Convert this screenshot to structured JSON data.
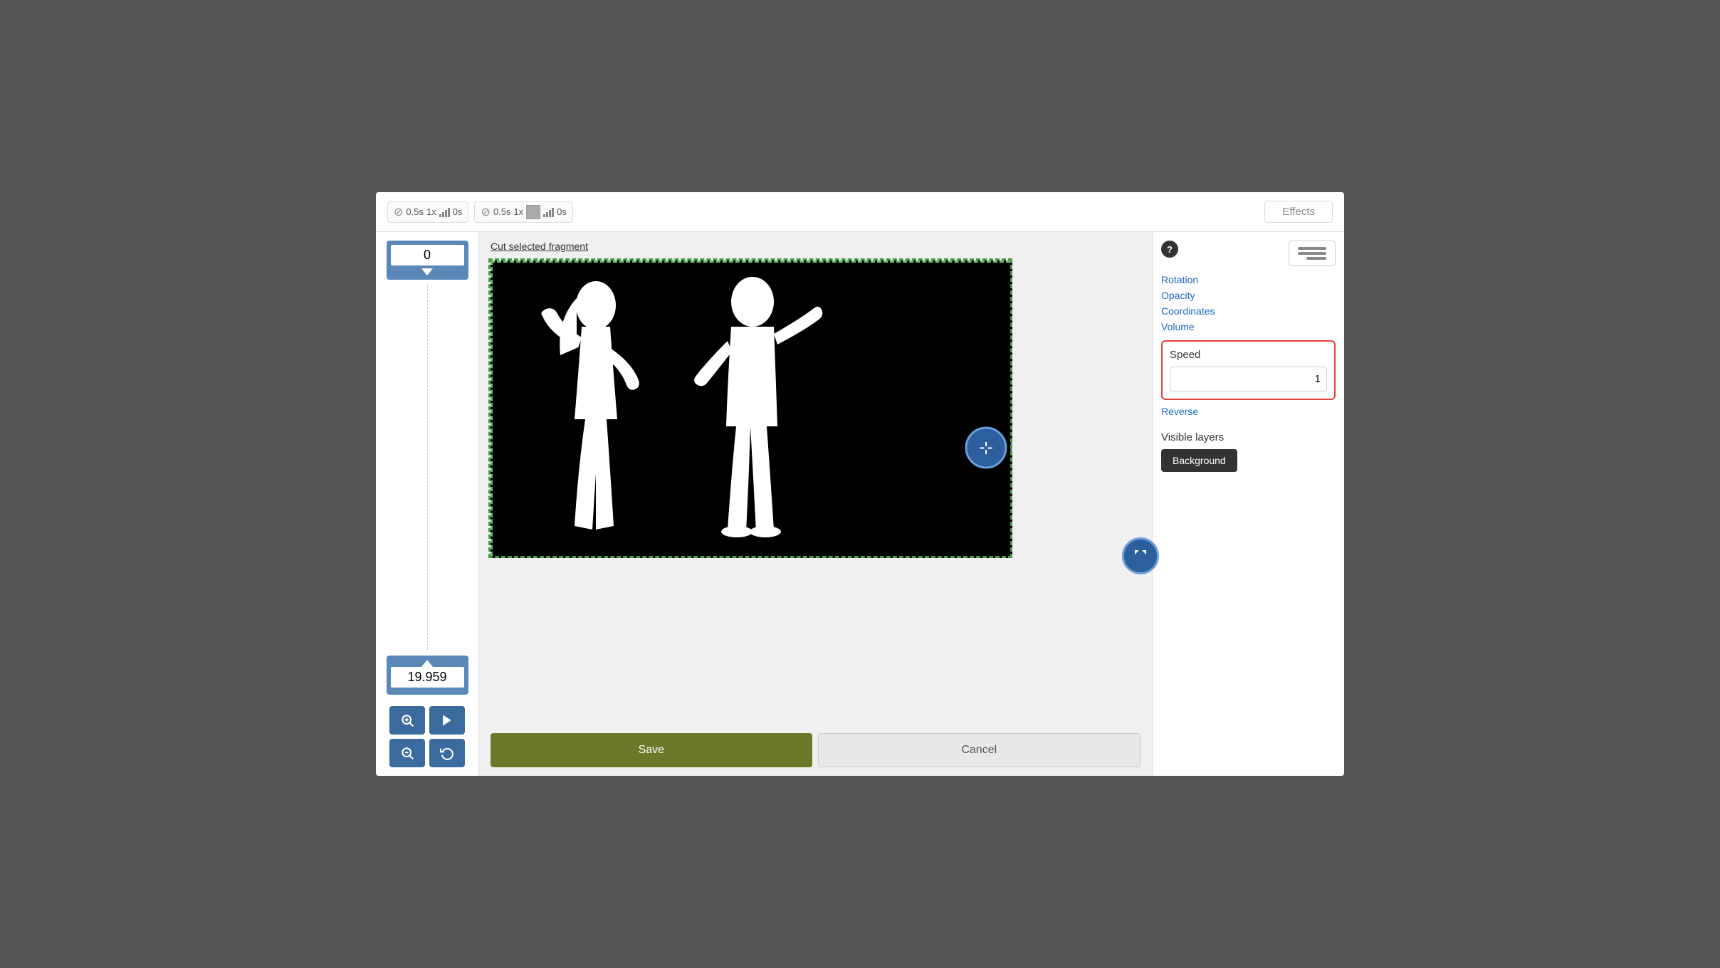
{
  "header": {
    "fade_in_duration": "0.5s",
    "fade_in_multiplier": "1x",
    "volume_in": "0s",
    "fade_out_duration": "0.5s",
    "fade_out_multiplier": "1x",
    "volume_out": "0s",
    "effects_label": "Effects"
  },
  "left_panel": {
    "top_counter_value": "0",
    "bottom_counter_value": "19.959",
    "zoom_in_label": "🔍",
    "zoom_out_label": "🔍",
    "play_label": "▶",
    "refresh_label": "↺"
  },
  "canvas": {
    "cut_link": "Cut selected fragment"
  },
  "right_panel": {
    "help_icon": "?",
    "rotation_label": "Rotation",
    "opacity_label": "Opacity",
    "coordinates_label": "Coordinates",
    "volume_label": "Volume",
    "speed_label": "Speed",
    "speed_value": "1",
    "reverse_label": "Reverse",
    "visible_layers_label": "Visible layers",
    "background_btn_label": "Background"
  },
  "actions": {
    "save_label": "Save",
    "cancel_label": "Cancel"
  }
}
